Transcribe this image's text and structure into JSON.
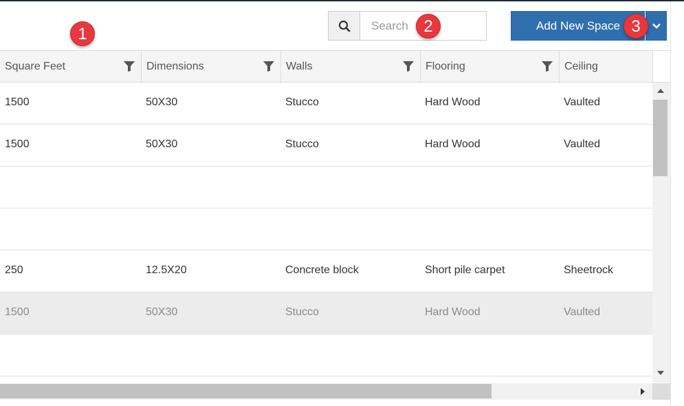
{
  "annotations": [
    "1",
    "2",
    "3"
  ],
  "search": {
    "placeholder": "Search",
    "icon": "search-icon"
  },
  "add_button": {
    "label": "Add New Space",
    "dropdown_icon": "chevron-down-icon"
  },
  "colors": {
    "primary": "#2f6fad",
    "marker": "#e8383d",
    "header_bg": "#f5f5f5",
    "selected_row": "#ececec"
  },
  "table": {
    "columns": [
      {
        "label": "Square Feet",
        "filter": true
      },
      {
        "label": "Dimensions",
        "filter": true
      },
      {
        "label": "Walls",
        "filter": true
      },
      {
        "label": "Flooring",
        "filter": true
      },
      {
        "label": "Ceiling",
        "filter": false
      }
    ],
    "rows": [
      {
        "cells": [
          "1500",
          "50X30",
          "Stucco",
          "Hard Wood",
          "Vaulted"
        ],
        "selected": false
      },
      {
        "cells": [
          "1500",
          "50X30",
          "Stucco",
          "Hard Wood",
          "Vaulted"
        ],
        "selected": false
      },
      {
        "cells": [
          "",
          "",
          "",
          "",
          ""
        ],
        "selected": false
      },
      {
        "cells": [
          "",
          "",
          "",
          "",
          ""
        ],
        "selected": false
      },
      {
        "cells": [
          "250",
          "12.5X20",
          "Concrete block",
          "Short pile carpet",
          "Sheetrock"
        ],
        "selected": false
      },
      {
        "cells": [
          "1500",
          "50X30",
          "Stucco",
          "Hard Wood",
          "Vaulted"
        ],
        "selected": true
      },
      {
        "cells": [
          "",
          "",
          "",
          "",
          ""
        ],
        "selected": false
      }
    ]
  }
}
